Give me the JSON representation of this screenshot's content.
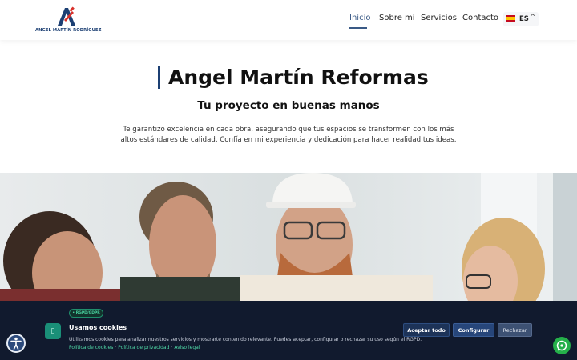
{
  "brand": {
    "logo_text": "ANGEL MARTÍN RODRÍGUEZ",
    "primary_color": "#1c3f73",
    "accent_color": "#d9312b"
  },
  "nav": {
    "items": [
      {
        "label": "Inicio",
        "active": true
      },
      {
        "label": "Sobre mí",
        "active": false
      },
      {
        "label": "Servicios",
        "active": false
      },
      {
        "label": "Contacto",
        "active": false
      }
    ],
    "language": {
      "code": "ES",
      "flag_icon": "spain-flag-icon"
    }
  },
  "hero": {
    "title": "Angel Martín Reformas",
    "subtitle": "Tu proyecto en buenas manos",
    "description_line1": "Te garantizo excelencia en cada obra, asegurando que tus espacios se transformen con los más",
    "description_line2": "altos estándares de calidad. Confía en mi experiencia y dedicación para hacer realidad tus ideas."
  },
  "cookie_banner": {
    "badge": "• RGPD/GDPR",
    "title": "Usamos cookies",
    "text": "Utilizamos cookies para analizar nuestros servicios y mostrarte contenido relevante. Puedes aceptar, configurar o rechazar su uso según el RGPD.",
    "links": [
      {
        "label": "Política de cookies"
      },
      {
        "label": "Política de privacidad"
      },
      {
        "label": "Aviso legal"
      }
    ],
    "buttons": {
      "accept": "Aceptar todo",
      "configure": "Configurar",
      "reject": "Rechazar"
    },
    "icon": "cookie-icon"
  },
  "floating": {
    "accessibility_icon": "accessibility-icon",
    "whatsapp_icon": "whatsapp-icon"
  }
}
